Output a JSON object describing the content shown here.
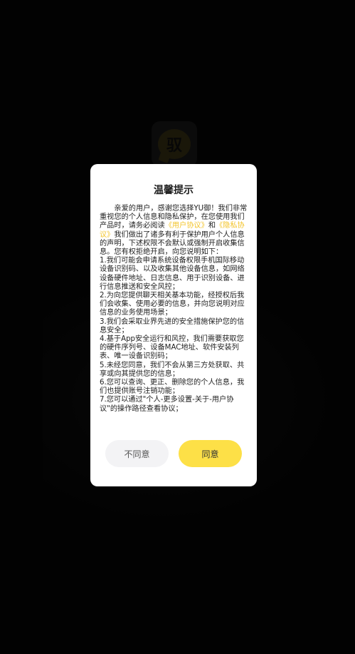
{
  "app": {
    "logo_text": "驭"
  },
  "dialog": {
    "title": "温馨提示",
    "intro_before_link1": "亲爱的用户，感谢您选择YU御！我们非常重视您的个人信息和隐私保护，在您使用我们产品时，请务必阅读",
    "link_user_agreement": "《用户协议》",
    "intro_and": "和",
    "link_privacy": "《隐私协议》",
    "intro_after_links": "我们做出了诸多有利于保护用户个人信息的声明，下述权限不会默认或强制开启收集信息。您有权拒绝开启，向您说明如下：",
    "items": [
      "1.我们可能会申请系统设备权限手机国际移动设备识别码、以及收集其他设备信息，如网络设备硬件地址、日志信息、用于识别设备、进行信息推送和安全风控；",
      "2.为向您提供聊天相关基本功能，经授权后我们会收集、使用必要的信息，并向您说明对应信息的业务使用场景；",
      "3.我们会采取业界先进的安全措施保护您的信息安全；",
      "4.基于App安全运行和风控，我们需要获取您的硬件序列号、设备MAC地址、软件安装列表、唯一设备识别码；",
      "5.未经您同意，我们不会从第三方处获取、共享或向其提供您的信息；",
      "6.您可以查询、更正、删除您的个人信息，我们也提供账号注销功能；",
      "7.您可以通过\"个人-更多设置-关于-用户协议\"的操作路径查看协议；"
    ],
    "disagree_label": "不同意",
    "agree_label": "同意"
  }
}
